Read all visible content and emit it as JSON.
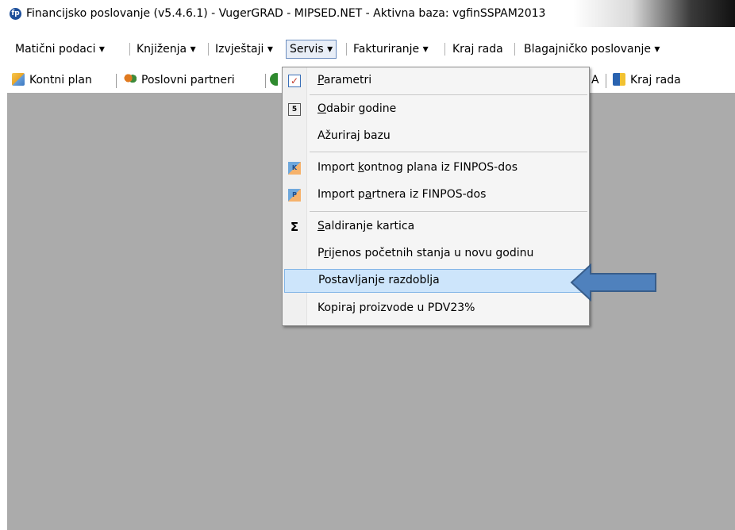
{
  "window": {
    "title": "Financijsko poslovanje (v5.4.6.1) - VugerGRAD - MIPSED.NET - Aktivna baza: vgfinSSPAM2013",
    "icon_text": "fp"
  },
  "menubar": {
    "items": [
      {
        "label": "Matični podaci ▾"
      },
      {
        "label": "Knjiženja ▾"
      },
      {
        "label": "Izvještaji ▾"
      },
      {
        "label": "Servis ▾"
      },
      {
        "label": "Fakturiranje ▾"
      },
      {
        "label": "Kraj rada"
      },
      {
        "label": "Blagajničko poslovanje ▾"
      }
    ]
  },
  "toolbar": {
    "kontni_plan": "Kontni plan",
    "poslovni_partneri": "Poslovni partneri",
    "a_fragment": "A",
    "kraj_rada": "Kraj rada"
  },
  "servis_menu": {
    "items": [
      {
        "label": "Parametri",
        "icon": "checkbox-icon"
      },
      {
        "label": "Odabir godine",
        "icon": "calendar-icon"
      },
      {
        "label": "Ažuriraj bazu",
        "icon": ""
      },
      {
        "label": "Import kontnog plana iz FINPOS-dos",
        "icon": "import-k-icon"
      },
      {
        "label": "Import partnera iz FINPOS-dos",
        "icon": "import-p-icon"
      },
      {
        "label": "Saldiranje kartica",
        "icon": "sigma-icon"
      },
      {
        "label": "Prijenos početnih stanja u novu godinu",
        "icon": ""
      },
      {
        "label": "Postavljanje razdoblja",
        "icon": "",
        "highlighted": true
      },
      {
        "label": "Kopiraj proizvode u PDV23%",
        "icon": ""
      }
    ]
  },
  "colors": {
    "highlight": "#cde5fb",
    "arrow": "#4f81bd",
    "workspace": "#ababab"
  }
}
